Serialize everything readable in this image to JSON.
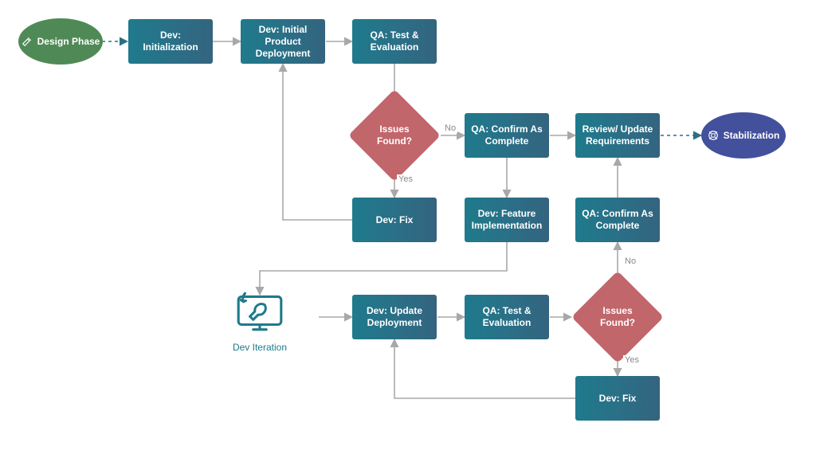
{
  "terminators": {
    "start": {
      "label": "Design Phase"
    },
    "end": {
      "label": "Stabilization"
    }
  },
  "iteration": {
    "label": "Dev Iteration"
  },
  "nodes": {
    "init": {
      "label": "Dev: Initialization"
    },
    "deploy": {
      "label": "Dev: Initial Product Deployment"
    },
    "qa1": {
      "label": "QA: Test & Evaluation"
    },
    "issues1": {
      "label": "Issues\nFound?"
    },
    "fix1": {
      "label": "Dev: Fix"
    },
    "confirm1": {
      "label": "QA: Confirm As Complete"
    },
    "review": {
      "label": "Review/ Update Requirements"
    },
    "feature": {
      "label": "Dev: Feature Implementation"
    },
    "update": {
      "label": "Dev: Update Deployment"
    },
    "qa2": {
      "label": "QA: Test & Evaluation"
    },
    "issues2": {
      "label": "Issues\nFound?"
    },
    "confirm2": {
      "label": "QA: Confirm As Complete"
    },
    "fix2": {
      "label": "Dev: Fix"
    }
  },
  "edgeLabels": {
    "no1": "No",
    "yes1": "Yes",
    "no2": "No",
    "yes2": "Yes"
  },
  "colors": {
    "processGradientFrom": "#1f7a8c",
    "processGradientTo": "#34647f",
    "decision": "#c1666b",
    "terminatorStart": "#4f8a56",
    "terminatorEnd": "#43509c",
    "iterationAccent": "#1f7a8c",
    "arrowStroke": "#a8a8a8"
  }
}
